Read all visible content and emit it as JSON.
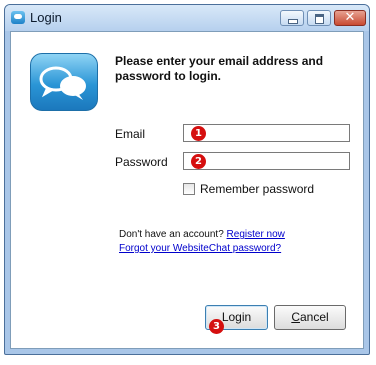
{
  "window": {
    "title": "Login",
    "controls": {
      "minimize": "minimize",
      "maximize": "maximize",
      "close": "✕"
    }
  },
  "intro_text": "Please enter your email address and password to login.",
  "form": {
    "email_label": "Email",
    "email_value": "",
    "password_label": "Password",
    "password_value": "",
    "remember_label": "Remember password",
    "remember_checked": false
  },
  "links": {
    "no_account_text": "Don't have an account?",
    "register_label": "Register now",
    "forgot_label": "Forgot your WebsiteChat password?"
  },
  "buttons": {
    "login_label": "Login",
    "cancel_prefix": "C",
    "cancel_rest": "ancel"
  },
  "markers": [
    "1",
    "2",
    "3"
  ],
  "icons": {
    "app": "chat-bubbles-icon",
    "logo": "chat-bubbles-logo"
  },
  "colors": {
    "window_frame": "#a9c6e8",
    "title_gradient_top": "#d8e8f8",
    "close_button": "#c84a32",
    "link": "#0000cc",
    "marker": "#d50f0f",
    "logo_blue": "#2a95d6"
  }
}
